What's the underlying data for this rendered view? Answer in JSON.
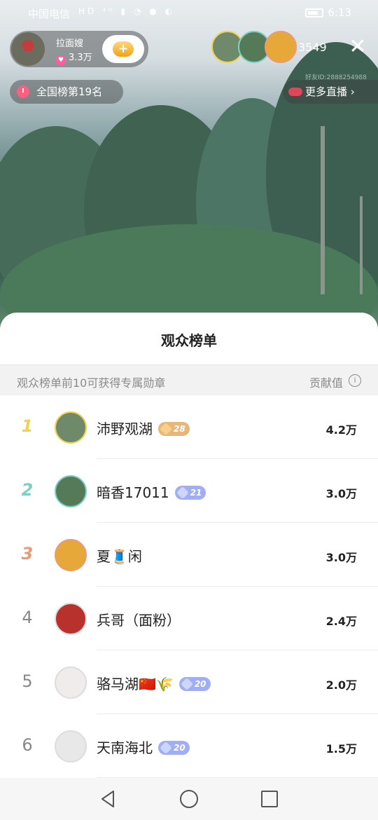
{
  "status_bar": {
    "carrier": "中国电信",
    "icons": "HD ⁴ᴳ ▮ ◔ ● ◐",
    "time": "6:13"
  },
  "host": {
    "name": "拉面嫂",
    "likes": "3.3万",
    "follow_icon": "plus-icon"
  },
  "viewers": {
    "count": "3549"
  },
  "rank_pill": {
    "label": "全国榜第19名"
  },
  "more_live": {
    "label": "更多直播",
    "chevron": "›"
  },
  "room_id": "好友ID:2888254988",
  "sheet": {
    "title": "观众榜单",
    "subtitle": "观众榜单前10可获得专属勋章",
    "value_header": "贡献值"
  },
  "ranking": [
    {
      "rank": "1",
      "name": "沛野观湖",
      "badge": "28",
      "badge_color": "gold",
      "value": "4.2万",
      "avatar_color": "#6f8a6a",
      "border": "#f3d24e"
    },
    {
      "rank": "2",
      "name": "暗香17011",
      "badge": "21",
      "badge_color": "blue",
      "value": "3.0万",
      "avatar_color": "#557a58",
      "border": "#7ed0c4"
    },
    {
      "rank": "3",
      "name": "夏🧵闲",
      "badge": "",
      "badge_color": "",
      "value": "3.0万",
      "avatar_color": "#e7a83a",
      "border": "#eb9a76"
    },
    {
      "rank": "4",
      "name": "兵哥（面粉）",
      "badge": "",
      "badge_color": "",
      "value": "2.4万",
      "avatar_color": "#b9312c",
      "border": "#dddddd"
    },
    {
      "rank": "5",
      "name": "骆马湖🇨🇳🌾",
      "badge": "20",
      "badge_color": "blue",
      "value": "2.0万",
      "avatar_color": "#f0ecec",
      "border": "#dddddd"
    },
    {
      "rank": "6",
      "name": "天南海北",
      "badge": "20",
      "badge_color": "blue",
      "value": "1.5万",
      "avatar_color": "#e8e8e8",
      "border": "#dddddd"
    }
  ],
  "nav": {
    "back_icon": "triangle-back-icon",
    "home_icon": "circle-home-icon",
    "recent_icon": "square-recent-icon"
  }
}
